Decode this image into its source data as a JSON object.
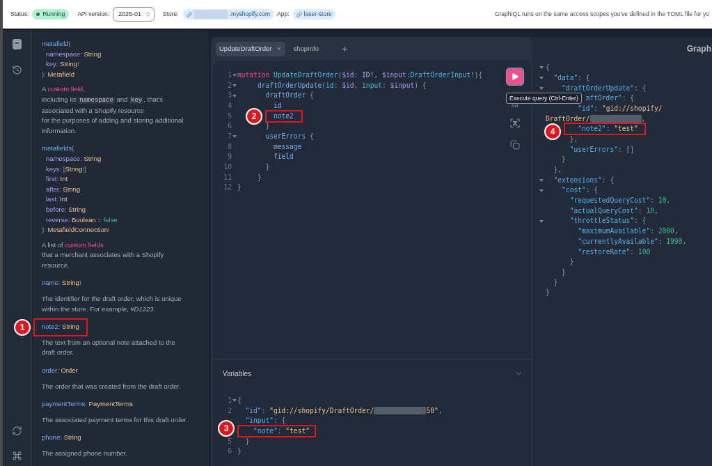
{
  "top_bar": {
    "status": {
      "label": "Status:",
      "value": "Running"
    },
    "api_version": {
      "label": "API version:",
      "value": "2025-01"
    },
    "store": {
      "label": "Store:",
      "redacted": true,
      "value": ".myshopify.com"
    },
    "app": {
      "label": "App:",
      "value": "laser-store"
    },
    "notice": "GraphiQL runs on the same access scopes you've defined in the TOML file for yo"
  },
  "sidebar": {
    "top_buttons": [
      {
        "kind": "docs",
        "selected": true
      },
      {
        "kind": "history",
        "selected": false
      }
    ],
    "bottom_buttons": [
      {
        "kind": "refresh"
      },
      {
        "kind": "shortcuts"
      }
    ]
  },
  "docs": {
    "items": [
      {
        "kind": "signature",
        "head": [
          {
            "kind": "field",
            "text": "metafield"
          },
          {
            "kind": "punct",
            "text": "("
          }
        ],
        "args": [
          [
            {
              "kind": "arg",
              "text": "namespace"
            },
            {
              "kind": "punct",
              "text": ": "
            },
            {
              "kind": "type",
              "text": "String"
            }
          ],
          [
            {
              "kind": "arg",
              "text": "key"
            },
            {
              "kind": "punct",
              "text": ": "
            },
            {
              "kind": "type",
              "text": "String"
            },
            {
              "kind": "punct",
              "text": "!"
            }
          ]
        ],
        "tail": [
          {
            "kind": "punct",
            "text": "): "
          },
          {
            "kind": "type",
            "text": "Metafield"
          }
        ]
      },
      {
        "kind": "description",
        "lines": [
          [
            {
              "kind": "plain",
              "text": "A "
            },
            {
              "kind": "link",
              "text": "custom field"
            },
            {
              "kind": "plain",
              "text": ","
            }
          ],
          [
            {
              "kind": "plain",
              "text": "including its "
            },
            {
              "kind": "code",
              "text": "namespace"
            },
            {
              "kind": "plain",
              "text": " and "
            },
            {
              "kind": "code",
              "text": "key"
            },
            {
              "kind": "plain",
              "text": ", that's"
            }
          ],
          [
            {
              "kind": "plain",
              "text": "associated with a Shopify resource"
            }
          ],
          [
            {
              "kind": "plain",
              "text": "for the purposes of adding and storing additional"
            }
          ],
          [
            {
              "kind": "plain",
              "text": "information."
            }
          ]
        ]
      },
      {
        "kind": "signature",
        "head": [
          {
            "kind": "field",
            "text": "metafields"
          },
          {
            "kind": "punct",
            "text": "("
          }
        ],
        "args": [
          [
            {
              "kind": "arg",
              "text": "namespace"
            },
            {
              "kind": "punct",
              "text": ": "
            },
            {
              "kind": "type",
              "text": "String"
            }
          ],
          [
            {
              "kind": "arg",
              "text": "keys"
            },
            {
              "kind": "punct",
              "text": ": "
            },
            {
              "kind": "punct",
              "text": "["
            },
            {
              "kind": "type",
              "text": "String"
            },
            {
              "kind": "punct",
              "text": "!]"
            }
          ],
          [
            {
              "kind": "arg",
              "text": "first"
            },
            {
              "kind": "punct",
              "text": ": "
            },
            {
              "kind": "type",
              "text": "Int"
            }
          ],
          [
            {
              "kind": "arg",
              "text": "after"
            },
            {
              "kind": "punct",
              "text": ": "
            },
            {
              "kind": "type",
              "text": "String"
            }
          ],
          [
            {
              "kind": "arg",
              "text": "last"
            },
            {
              "kind": "punct",
              "text": ": "
            },
            {
              "kind": "type",
              "text": "Int"
            }
          ],
          [
            {
              "kind": "arg",
              "text": "before"
            },
            {
              "kind": "punct",
              "text": ": "
            },
            {
              "kind": "type",
              "text": "String"
            }
          ],
          [
            {
              "kind": "arg",
              "text": "reverse"
            },
            {
              "kind": "punct",
              "text": ": "
            },
            {
              "kind": "type",
              "text": "Boolean"
            },
            {
              "kind": "punct",
              "text": " = "
            },
            {
              "kind": "value",
              "text": "false"
            }
          ]
        ],
        "tail": [
          {
            "kind": "punct",
            "text": "): "
          },
          {
            "kind": "type",
            "text": "MetafieldConnection"
          },
          {
            "kind": "punct",
            "text": "!"
          }
        ]
      },
      {
        "kind": "description",
        "lines": [
          [
            {
              "kind": "plain",
              "text": "A list of "
            },
            {
              "kind": "link",
              "text": "custom fields"
            }
          ],
          [
            {
              "kind": "plain",
              "text": "that a merchant associates with a Shopify"
            }
          ],
          [
            {
              "kind": "plain",
              "text": "resource."
            }
          ]
        ]
      },
      {
        "kind": "field",
        "tokens": [
          {
            "kind": "field",
            "text": "name"
          },
          {
            "kind": "punct",
            "text": ": "
          },
          {
            "kind": "type",
            "text": "String"
          },
          {
            "kind": "punct",
            "text": "!"
          }
        ]
      },
      {
        "kind": "description",
        "lines": [
          [
            {
              "kind": "plain",
              "text": "The identifier for the draft order, which is unique"
            }
          ],
          [
            {
              "kind": "plain",
              "text": "within the store. For example, "
            },
            {
              "kind": "emphasis",
              "text": "#D1223"
            },
            {
              "kind": "plain",
              "text": "."
            }
          ]
        ]
      },
      {
        "kind": "field",
        "callout": "1",
        "tokens": [
          {
            "kind": "field",
            "text": "note2"
          },
          {
            "kind": "punct",
            "text": ": "
          },
          {
            "kind": "type",
            "text": "String"
          }
        ]
      },
      {
        "kind": "description",
        "lines": [
          [
            {
              "kind": "plain",
              "text": "The text from an optional note attached to the"
            }
          ],
          [
            {
              "kind": "plain",
              "text": "draft order."
            }
          ]
        ]
      },
      {
        "kind": "field",
        "tokens": [
          {
            "kind": "field",
            "text": "order"
          },
          {
            "kind": "punct",
            "text": ": "
          },
          {
            "kind": "type",
            "text": "Order"
          }
        ]
      },
      {
        "kind": "description",
        "lines": [
          [
            {
              "kind": "plain",
              "text": "The order that was created from the draft order."
            }
          ]
        ]
      },
      {
        "kind": "field",
        "tokens": [
          {
            "kind": "field",
            "text": "paymentTerms"
          },
          {
            "kind": "punct",
            "text": ": "
          },
          {
            "kind": "type",
            "text": "PaymentTerms"
          }
        ]
      },
      {
        "kind": "description",
        "lines": [
          [
            {
              "kind": "plain",
              "text": "The associated payment terms for this draft order."
            }
          ]
        ]
      },
      {
        "kind": "field",
        "tokens": [
          {
            "kind": "field",
            "text": "phone"
          },
          {
            "kind": "punct",
            "text": ": "
          },
          {
            "kind": "type",
            "text": "String"
          }
        ]
      },
      {
        "kind": "description",
        "lines": [
          [
            {
              "kind": "plain",
              "text": "The assigned phone number."
            }
          ]
        ]
      }
    ]
  },
  "editor": {
    "tabs": [
      {
        "label": "UpdateDraftOrder",
        "selected": true
      },
      {
        "label": "shopInfo",
        "selected": false
      }
    ],
    "query": {
      "lines": [
        {
          "number": "1",
          "fold": true,
          "tokens": [
            {
              "kind": "keyword",
              "text": "mutation"
            },
            {
              "kind": "def",
              "text": " UpdateDraftOrder"
            },
            {
              "kind": "punct",
              "text": "("
            },
            {
              "kind": "variable",
              "text": "$id"
            },
            {
              "kind": "punct",
              "text": ": "
            },
            {
              "kind": "scalar",
              "text": "ID!"
            },
            {
              "kind": "punct",
              "text": ", "
            },
            {
              "kind": "variable",
              "text": "$input"
            },
            {
              "kind": "punct",
              "text": ":"
            },
            {
              "kind": "def",
              "text": "DraftOrderInput"
            },
            {
              "kind": "punct",
              "text": "!){"
            }
          ],
          "children": [
            {
              "number": "2",
              "fold": true,
              "tokens": [
                {
                  "kind": "field",
                  "text": "draftOrderUpdate"
                },
                {
                  "kind": "punct",
                  "text": "("
                },
                {
                  "kind": "param",
                  "text": "id"
                },
                {
                  "kind": "punct",
                  "text": ": "
                },
                {
                  "kind": "variable",
                  "text": "$id"
                },
                {
                  "kind": "punct",
                  "text": ", "
                },
                {
                  "kind": "param",
                  "text": "input"
                },
                {
                  "kind": "punct",
                  "text": ": "
                },
                {
                  "kind": "variable",
                  "text": "$input"
                },
                {
                  "kind": "punct",
                  "text": ") {"
                }
              ],
              "children": [
                {
                  "number": "3",
                  "fold": true,
                  "tokens": [
                    {
                      "kind": "field",
                      "text": "draftOrder"
                    },
                    {
                      "kind": "punct",
                      "text": " {"
                    }
                  ],
                  "children": [
                    {
                      "number": "4",
                      "fold": false,
                      "tokens": [
                        {
                          "kind": "field",
                          "text": "id"
                        }
                      ]
                    },
                    {
                      "number": "5",
                      "fold": false,
                      "callout": "2",
                      "tokens": [
                        {
                          "kind": "field",
                          "text": "note2"
                        }
                      ]
                    }
                  ]
                },
                {
                  "number": "6",
                  "fold": false,
                  "tokens": [
                    {
                      "kind": "punct",
                      "text": "}"
                    }
                  ]
                },
                {
                  "number": "7",
                  "fold": true,
                  "tokens": [
                    {
                      "kind": "field",
                      "text": "userErrors"
                    },
                    {
                      "kind": "punct",
                      "text": " {"
                    }
                  ],
                  "children": [
                    {
                      "number": "8",
                      "fold": false,
                      "tokens": [
                        {
                          "kind": "field",
                          "text": "message"
                        }
                      ]
                    },
                    {
                      "number": "9",
                      "fold": false,
                      "tokens": [
                        {
                          "kind": "field",
                          "text": "field"
                        }
                      ]
                    }
                  ]
                },
                {
                  "number": "10",
                  "fold": false,
                  "tokens": [
                    {
                      "kind": "punct",
                      "text": "}"
                    }
                  ]
                }
              ]
            },
            {
              "number": "11",
              "fold": false,
              "tokens": [
                {
                  "kind": "punct",
                  "text": "}"
                }
              ]
            }
          ]
        },
        {
          "number": "12",
          "fold": false,
          "tokens": [
            {
              "kind": "punct",
              "text": "}"
            }
          ]
        }
      ]
    },
    "run_tooltip": "Execute query (Ctrl-Enter)",
    "variables": {
      "title": "Variables",
      "expanded": true,
      "lines": [
        {
          "number": "1",
          "fold": true,
          "tokens": [
            {
              "kind": "punct",
              "text": "{"
            }
          ],
          "children": [
            {
              "number": "2",
              "fold": false,
              "tokens": [
                {
                  "kind": "key",
                  "text": "\"id\""
                },
                {
                  "kind": "punct",
                  "text": ": "
                },
                {
                  "kind": "string",
                  "text": "\"gid://shopify/DraftOrder/"
                },
                {
                  "kind": "redacted"
                },
                {
                  "kind": "string",
                  "text": "50\""
                },
                {
                  "kind": "punct",
                  "text": ","
                }
              ]
            },
            {
              "fold": false,
              "tokens": [
                {
                  "kind": "key",
                  "text": "\"input\""
                },
                {
                  "kind": "punct",
                  "text": ": {"
                }
              ],
              "children": [
                {
                  "fold": false,
                  "callout": "3",
                  "tokens": [
                    {
                      "kind": "key",
                      "text": "\"note\""
                    },
                    {
                      "kind": "punct",
                      "text": ": "
                    },
                    {
                      "kind": "string",
                      "text": "\"test\""
                    }
                  ]
                }
              ]
            },
            {
              "number": "5",
              "fold": false,
              "tokens": [
                {
                  "kind": "punct",
                  "text": "}"
                }
              ]
            }
          ]
        },
        {
          "number": "6",
          "fold": false,
          "tokens": [
            {
              "kind": "punct",
              "text": "}"
            }
          ]
        }
      ]
    }
  },
  "results": {
    "title": "Graph",
    "lines": [
      {
        "fold": true,
        "tokens": [
          {
            "kind": "punct",
            "text": "{"
          }
        ],
        "children": [
          {
            "fold": true,
            "tokens": [
              {
                "kind": "key",
                "text": "\"data\""
              },
              {
                "kind": "punct",
                "text": ": {"
              }
            ],
            "children": [
              {
                "fold": true,
                "tokens": [
                  {
                    "kind": "key",
                    "text": "\"draftOrderUpdate\""
                  },
                  {
                    "kind": "punct",
                    "text": ": {"
                  }
                ],
                "children": [
                  {
                    "kind": "covered",
                    "fold": false,
                    "tokens": [
                      {
                        "kind": "key",
                        "text": "aftOrder\""
                      },
                      {
                        "kind": "punct",
                        "text": ": {"
                      }
                    ],
                    "children": [
                      {
                        "kind": "line",
                        "fold": false,
                        "tokens": [
                          {
                            "kind": "key",
                            "text": "\"id\""
                          },
                          {
                            "kind": "punct",
                            "text": ": "
                          },
                          {
                            "kind": "string",
                            "text": "\"gid://shopify/"
                          }
                        ]
                      },
                      {
                        "kind": "continuation",
                        "fold": false,
                        "tokens": [
                          {
                            "kind": "string",
                            "text": "DraftOrder/"
                          },
                          {
                            "kind": "redacted"
                          },
                          {
                            "kind": "punct",
                            "text": ","
                          }
                        ]
                      },
                      {
                        "kind": "line",
                        "fold": false,
                        "callout": "4",
                        "tokens": [
                          {
                            "kind": "key",
                            "text": "\"note2\""
                          },
                          {
                            "kind": "punct",
                            "text": ": "
                          },
                          {
                            "kind": "string",
                            "text": "\"test\""
                          }
                        ]
                      }
                    ]
                  },
                  {
                    "kind": "line",
                    "fold": false,
                    "tokens": [
                      {
                        "kind": "punct",
                        "text": "},"
                      }
                    ]
                  },
                  {
                    "kind": "line",
                    "fold": false,
                    "tokens": [
                      {
                        "kind": "key",
                        "text": "\"userErrors\""
                      },
                      {
                        "kind": "punct",
                        "text": ": []"
                      }
                    ]
                  }
                ]
              },
              {
                "fold": false,
                "tokens": [
                  {
                    "kind": "punct",
                    "text": "}"
                  }
                ]
              }
            ]
          },
          {
            "fold": false,
            "tokens": [
              {
                "kind": "punct",
                "text": "},"
              }
            ]
          },
          {
            "fold": true,
            "tokens": [
              {
                "kind": "key",
                "text": "\"extensions\""
              },
              {
                "kind": "punct",
                "text": ": {"
              }
            ],
            "children": [
              {
                "fold": true,
                "tokens": [
                  {
                    "kind": "key",
                    "text": "\"cost\""
                  },
                  {
                    "kind": "punct",
                    "text": ": {"
                  }
                ],
                "children": [
                  {
                    "fold": false,
                    "tokens": [
                      {
                        "kind": "key",
                        "text": "\"requestedQueryCost\""
                      },
                      {
                        "kind": "punct",
                        "text": ": "
                      },
                      {
                        "kind": "number",
                        "text": "10"
                      },
                      {
                        "kind": "punct",
                        "text": ","
                      }
                    ]
                  },
                  {
                    "fold": false,
                    "tokens": [
                      {
                        "kind": "key",
                        "text": "\"actualQueryCost\""
                      },
                      {
                        "kind": "punct",
                        "text": ": "
                      },
                      {
                        "kind": "number",
                        "text": "10"
                      },
                      {
                        "kind": "punct",
                        "text": ","
                      }
                    ]
                  },
                  {
                    "fold": true,
                    "tokens": [
                      {
                        "kind": "key",
                        "text": "\"throttleStatus\""
                      },
                      {
                        "kind": "punct",
                        "text": ": {"
                      }
                    ],
                    "children": [
                      {
                        "fold": false,
                        "tokens": [
                          {
                            "kind": "key",
                            "text": "\"maximumAvailable\""
                          },
                          {
                            "kind": "punct",
                            "text": ": "
                          },
                          {
                            "kind": "number",
                            "text": "2000"
                          },
                          {
                            "kind": "punct",
                            "text": ","
                          }
                        ]
                      },
                      {
                        "fold": false,
                        "tokens": [
                          {
                            "kind": "key",
                            "text": "\"currentlyAvailable\""
                          },
                          {
                            "kind": "punct",
                            "text": ": "
                          },
                          {
                            "kind": "number",
                            "text": "1990"
                          },
                          {
                            "kind": "punct",
                            "text": ","
                          }
                        ]
                      },
                      {
                        "fold": false,
                        "tokens": [
                          {
                            "kind": "key",
                            "text": "\"restoreRate\""
                          },
                          {
                            "kind": "punct",
                            "text": ": "
                          },
                          {
                            "kind": "number",
                            "text": "100"
                          }
                        ]
                      }
                    ]
                  },
                  {
                    "fold": false,
                    "tokens": [
                      {
                        "kind": "punct",
                        "text": "}"
                      }
                    ]
                  }
                ]
              },
              {
                "fold": false,
                "tokens": [
                  {
                    "kind": "punct",
                    "text": "}"
                  }
                ]
              }
            ]
          },
          {
            "fold": false,
            "tokens": [
              {
                "kind": "punct",
                "text": "}"
              }
            ]
          }
        ]
      },
      {
        "fold": false,
        "tokens": [
          {
            "kind": "punct",
            "text": "}"
          }
        ]
      }
    ]
  }
}
